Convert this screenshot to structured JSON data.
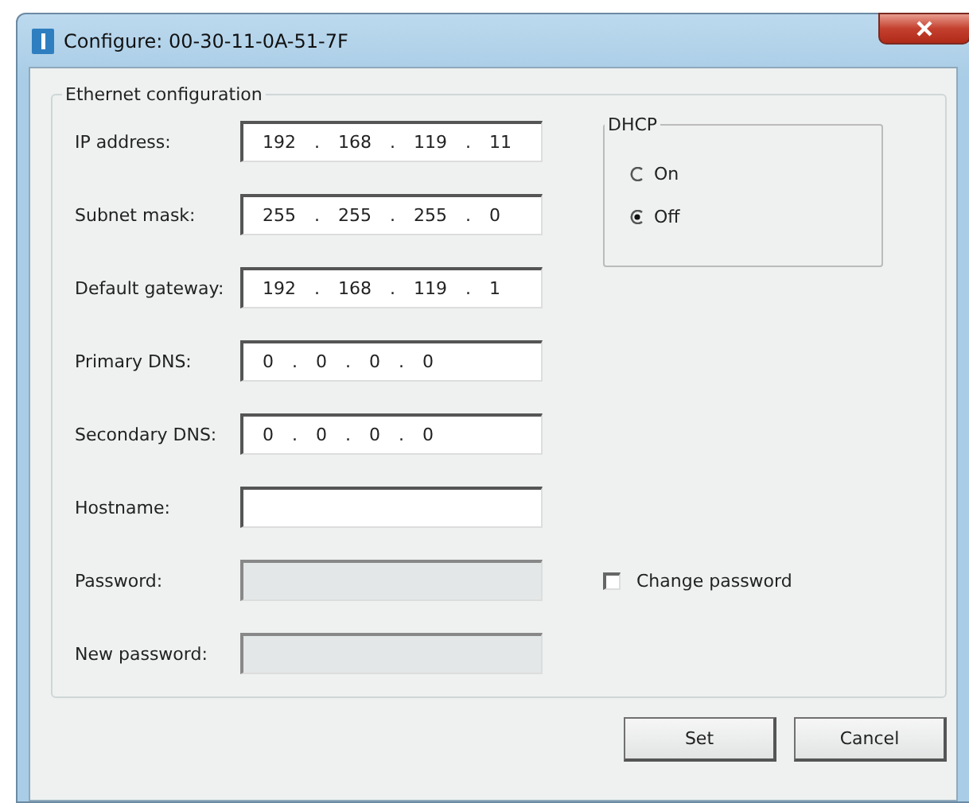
{
  "window": {
    "title": "Configure: 00-30-11-0A-51-7F"
  },
  "group": {
    "title": "Ethernet configuration"
  },
  "fields": [
    {
      "label": "IP address:",
      "value": "192 . 168 . 119 . 11",
      "disabled": false
    },
    {
      "label": "Subnet mask:",
      "value": "255 . 255 . 255 . 0",
      "disabled": false
    },
    {
      "label": "Default gateway:",
      "value": "192 . 168 . 119 . 1",
      "disabled": false
    },
    {
      "label": "Primary DNS:",
      "value": "0 . 0 . 0 . 0",
      "disabled": false
    },
    {
      "label": "Secondary DNS:",
      "value": "0 . 0 . 0 . 0",
      "disabled": false
    },
    {
      "label": "Hostname:",
      "disabled": false
    },
    {
      "label": "Password:",
      "disabled": true
    },
    {
      "label": "New password:",
      "disabled": true
    }
  ],
  "dhcp": {
    "title": "DHCP",
    "options": [
      {
        "label": "On",
        "selected": false
      },
      {
        "label": "Off",
        "selected": true
      }
    ]
  },
  "change_password": {
    "label": "Change password",
    "checked": false
  },
  "buttons": [
    "Set",
    "Cancel"
  ]
}
